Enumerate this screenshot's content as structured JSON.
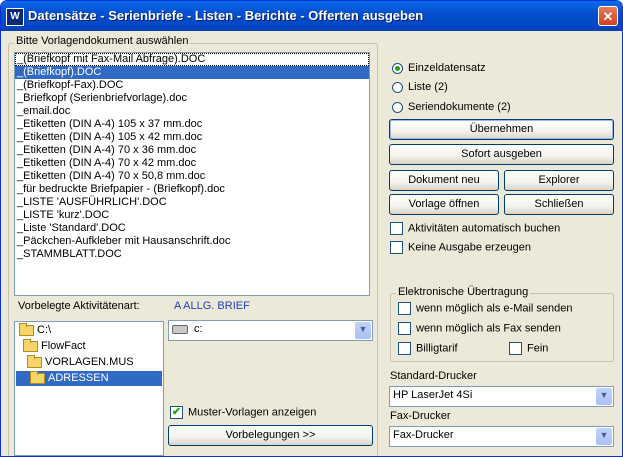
{
  "window": {
    "title": "Datensätze - Serienbriefe - Listen - Berichte - Offerten ausgeben",
    "app_icon": "W",
    "close_glyph": "✕"
  },
  "template_group": {
    "label": "Bitte Vorlagendokument auswählen",
    "items": [
      "_(Briefkopf mit Fax-Mail Abfrage).DOC",
      "_(Briefkopf).DOC",
      "_(Briefkopf-Fax).DOC",
      "_Briefkopf (Serienbriefvorlage).doc",
      "_email.doc",
      "_Etiketten (DIN A-4) 105 x 37 mm.doc",
      "_Etiketten (DIN A-4) 105 x 42 mm.doc",
      "_Etiketten (DIN A-4) 70 x 36 mm.doc",
      "_Etiketten (DIN A-4) 70 x 42 mm.doc",
      "_Etiketten (DIN A-4) 70 x 50,8 mm.doc",
      "_für bedruckte Briefpapier - (Briefkopf).doc",
      "_LISTE 'AUSFÜHRLICH'.DOC",
      "_LISTE 'kurz'.DOC",
      "_Liste 'Standard'.DOC",
      "_Päckchen-Aufkleber mit Hausanschrift.doc",
      "_STAMMBLATT.DOC"
    ],
    "selected_index": 1
  },
  "activity": {
    "label": "Vorbelegte Aktivitätenart:",
    "value": "A ALLG. BRIEF",
    "value_color": "#1c3fbf"
  },
  "folder_tree": [
    {
      "label": "C:\\"
    },
    {
      "label": "FlowFact"
    },
    {
      "label": "VORLAGEN.MUS"
    },
    {
      "label": "ADRESSEN"
    }
  ],
  "drive_combo": {
    "value": "c:"
  },
  "muster_checkbox": {
    "label": "Muster-Vorlagen anzeigen",
    "checked": true,
    "check_glyph": "✔"
  },
  "vorbelegungen_button": "Vorbelegungen >>",
  "output_mode": {
    "options": [
      "Einzeldatensatz",
      "Liste (2)",
      "Seriendokumente (2)"
    ],
    "selected_index": 0
  },
  "buttons": {
    "uebernehmen": "Übernehmen",
    "sofort": "Sofort ausgeben",
    "dokument_neu": "Dokument neu",
    "explorer": "Explorer",
    "vorlage_oeffnen": "Vorlage öffnen",
    "schliessen": "Schließen"
  },
  "options": {
    "auto_activities": "Aktivitäten automatisch buchen",
    "no_output": "Keine Ausgabe erzeugen"
  },
  "electronic": {
    "label": "Elektronische Übertragung",
    "email": "wenn möglich als e-Mail senden",
    "fax": "wenn möglich als Fax senden",
    "billigtarif": "Billigtarif",
    "fein": "Fein"
  },
  "printer": {
    "standard_label": "Standard-Drucker",
    "standard_value": "HP LaserJet 4Si",
    "fax_label": "Fax-Drucker",
    "fax_value": "Fax-Drucker"
  }
}
